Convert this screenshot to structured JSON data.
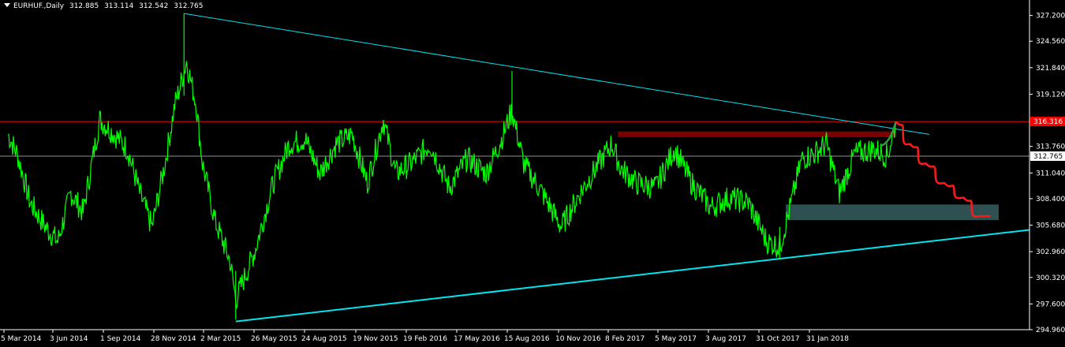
{
  "header": {
    "symbol": "EURHUF.,Daily",
    "open": "312.885",
    "high": "313.114",
    "low": "312.542",
    "close": "312.765"
  },
  "colors": {
    "background": "#000000",
    "axis": "#ffffff",
    "price_line": "#00ff00",
    "trend_line": "#00e5ee",
    "resistance_line": "#ff0000",
    "resistance_zone": "#7a0000",
    "support_zone": "#2f5050",
    "projection_up": "#2ea043",
    "projection_down": "#ff1a1a",
    "current_price_line": "#c0c0c0",
    "resistance_label_bg": "#ff0000",
    "current_label_bg": "#ffffff"
  },
  "chart_data": {
    "type": "line",
    "title": "EURHUF.,Daily",
    "ylim": [
      294.96,
      328.3
    ],
    "y_ticks": [
      "327.200",
      "324.560",
      "321.840",
      "319.120",
      "313.760",
      "311.040",
      "308.400",
      "305.680",
      "302.960",
      "300.320",
      "297.600",
      "294.960"
    ],
    "x_ticks": [
      "5 Mar 2014",
      "3 Jun 2014",
      "1 Sep 2014",
      "28 Nov 2014",
      "2 Mar 2015",
      "26 May 2015",
      "24 Aug 2015",
      "19 Nov 2015",
      "19 Feb 2016",
      "17 May 2016",
      "15 Aug 2016",
      "10 Nov 2016",
      "8 Feb 2017",
      "5 May 2017",
      "3 Aug 2017",
      "31 Oct 2017",
      "31 Jan 2018"
    ],
    "series": [
      {
        "name": "EURHUF close",
        "x": [
          "2014-03-05",
          "2014-03-20",
          "2014-04-10",
          "2014-05-05",
          "2014-05-25",
          "2014-06-15",
          "2014-07-05",
          "2014-08-01",
          "2014-08-25",
          "2014-09-15",
          "2014-10-05",
          "2014-10-25",
          "2014-11-15",
          "2014-12-01",
          "2014-12-10",
          "2014-12-20",
          "2015-01-05",
          "2015-01-15",
          "2015-02-05",
          "2015-03-01",
          "2015-03-10",
          "2015-04-10",
          "2015-05-10",
          "2015-06-05",
          "2015-07-01",
          "2015-07-25",
          "2015-08-20",
          "2015-09-15",
          "2015-10-10",
          "2015-11-05",
          "2015-11-25",
          "2015-12-20",
          "2016-01-20",
          "2016-02-20",
          "2016-03-20",
          "2016-04-20",
          "2016-05-15",
          "2016-06-01",
          "2016-06-20",
          "2016-07-20",
          "2016-08-20",
          "2016-09-20",
          "2016-10-20",
          "2016-11-10",
          "2016-11-25",
          "2016-12-20",
          "2017-01-20",
          "2017-02-20",
          "2017-03-20",
          "2017-04-20",
          "2017-05-20",
          "2017-06-20",
          "2017-07-20",
          "2017-08-10",
          "2017-08-25",
          "2017-09-15",
          "2017-10-05",
          "2017-10-25",
          "2017-11-15",
          "2017-12-10",
          "2018-01-10",
          "2018-02-01",
          "2018-02-15"
        ],
        "values": [
          315.0,
          313.0,
          308.0,
          305.5,
          304.0,
          309.0,
          307.0,
          316.5,
          315.0,
          313.5,
          309.0,
          305.5,
          312.0,
          318.0,
          320.0,
          322.5,
          318.0,
          312.0,
          306.0,
          302.0,
          298.0,
          303.0,
          310.0,
          314.0,
          314.5,
          311.0,
          314.0,
          315.0,
          310.0,
          316.5,
          311.0,
          312.0,
          314.0,
          309.5,
          312.5,
          311.0,
          314.5,
          317.5,
          312.0,
          309.0,
          305.5,
          309.0,
          312.0,
          314.0,
          311.5,
          310.0,
          309.5,
          313.5,
          310.0,
          307.5,
          308.5,
          308.0,
          304.0,
          303.5,
          307.0,
          312.5,
          313.0,
          314.0,
          309.0,
          313.0,
          313.5,
          312.76,
          316.3
        ]
      },
      {
        "name": "Projection",
        "x": [
          "2018-02-15",
          "2018-03-10",
          "2018-04-05",
          "2018-05-05",
          "2018-06-05",
          "2018-07-01"
        ],
        "values": [
          316.3,
          314.0,
          312.0,
          310.0,
          308.5,
          306.6
        ]
      }
    ],
    "trendlines": [
      {
        "from": {
          "x": "2014-12-16",
          "y": 327.4
        },
        "to": {
          "x": "2018-04-10",
          "y": 315.0
        }
      },
      {
        "from": {
          "x": "2015-03-10",
          "y": 295.8
        },
        "to": {
          "x": "2018-09-20",
          "y": 305.2
        }
      }
    ],
    "resistance_level": "316.316",
    "current_price": "312.765",
    "resistance_zone": {
      "x_from": "2016-11-20",
      "x_to": "2018-02-15",
      "y_from": 314.7,
      "y_to": 315.3
    },
    "support_zone": {
      "x_from": "2017-08-20",
      "x_to": "2018-08-01",
      "y_from": 306.2,
      "y_to": 307.8
    }
  }
}
